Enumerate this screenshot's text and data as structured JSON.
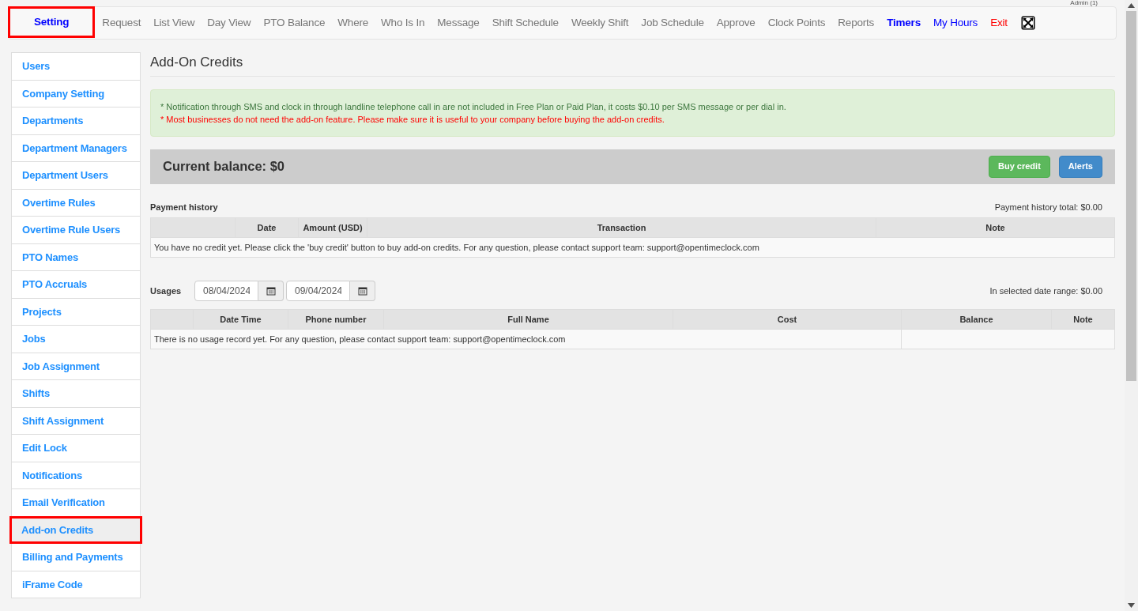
{
  "user_label": "Admin (1)",
  "nav": [
    {
      "label": "Setting",
      "kind": "strong",
      "highlighted": true
    },
    {
      "label": "Request",
      "kind": "normal",
      "highlighted": false
    },
    {
      "label": "List View",
      "kind": "normal",
      "highlighted": false
    },
    {
      "label": "Day View",
      "kind": "normal",
      "highlighted": false
    },
    {
      "label": "PTO Balance",
      "kind": "normal",
      "highlighted": false
    },
    {
      "label": "Where",
      "kind": "normal",
      "highlighted": false
    },
    {
      "label": "Who Is In",
      "kind": "normal",
      "highlighted": false
    },
    {
      "label": "Message",
      "kind": "normal",
      "highlighted": false
    },
    {
      "label": "Shift Schedule",
      "kind": "normal",
      "highlighted": false
    },
    {
      "label": "Weekly Shift",
      "kind": "normal",
      "highlighted": false
    },
    {
      "label": "Job Schedule",
      "kind": "normal",
      "highlighted": false
    },
    {
      "label": "Approve",
      "kind": "normal",
      "highlighted": false
    },
    {
      "label": "Clock Points",
      "kind": "normal",
      "highlighted": false
    },
    {
      "label": "Reports",
      "kind": "normal",
      "highlighted": false
    },
    {
      "label": "Timers",
      "kind": "strong",
      "highlighted": false
    },
    {
      "label": "My Hours",
      "kind": "link",
      "highlighted": false
    },
    {
      "label": "Exit",
      "kind": "danger",
      "highlighted": false
    }
  ],
  "sidebar": {
    "items": [
      {
        "label": "Users",
        "selected": false
      },
      {
        "label": "Company Setting",
        "selected": false
      },
      {
        "label": "Departments",
        "selected": false
      },
      {
        "label": "Department Managers",
        "selected": false
      },
      {
        "label": "Department Users",
        "selected": false
      },
      {
        "label": "Overtime Rules",
        "selected": false
      },
      {
        "label": "Overtime Rule Users",
        "selected": false
      },
      {
        "label": "PTO Names",
        "selected": false
      },
      {
        "label": "PTO Accruals",
        "selected": false
      },
      {
        "label": "Projects",
        "selected": false
      },
      {
        "label": "Jobs",
        "selected": false
      },
      {
        "label": "Job Assignment",
        "selected": false
      },
      {
        "label": "Shifts",
        "selected": false
      },
      {
        "label": "Shift Assignment",
        "selected": false
      },
      {
        "label": "Edit Lock",
        "selected": false
      },
      {
        "label": "Notifications",
        "selected": false
      },
      {
        "label": "Email Verification",
        "selected": false
      },
      {
        "label": "Add-on Credits",
        "selected": true
      },
      {
        "label": "Billing and Payments",
        "selected": false
      },
      {
        "label": "iFrame Code",
        "selected": false
      }
    ]
  },
  "page_title": "Add-On Credits",
  "notice": {
    "info": "* Notification through SMS and clock in through landline telephone call in are not included in Free Plan or Paid Plan, it costs $0.10 per SMS message or per dial in.",
    "warning": "* Most businesses do not need the add-on feature. Please make sure it is useful to your company before buying the add-on credits."
  },
  "balance": {
    "text": "Current balance: $0",
    "buttons": [
      {
        "label": "Buy credit",
        "kind": "success"
      },
      {
        "label": "Alerts",
        "kind": "primary"
      }
    ]
  },
  "payment_history": {
    "title": "Payment history",
    "total": "Payment history total: $0.00",
    "columns": [
      "",
      "Date",
      "Amount (USD)",
      "Transaction",
      "Note"
    ],
    "empty": "You have no credit yet. Please click the 'buy credit' button to buy add-on credits. For any question, please contact support team: support@opentimeclock.com"
  },
  "usages": {
    "title": "Usages",
    "date_from": "08/04/2024",
    "date_to": "09/04/2024",
    "total": "In selected date range: $0.00",
    "columns": [
      "",
      "Date Time",
      "Phone number",
      "Full Name",
      "Cost",
      "Balance",
      "Note"
    ],
    "empty": "There is no usage record yet. For any question, please contact support team: support@opentimeclock.com"
  }
}
